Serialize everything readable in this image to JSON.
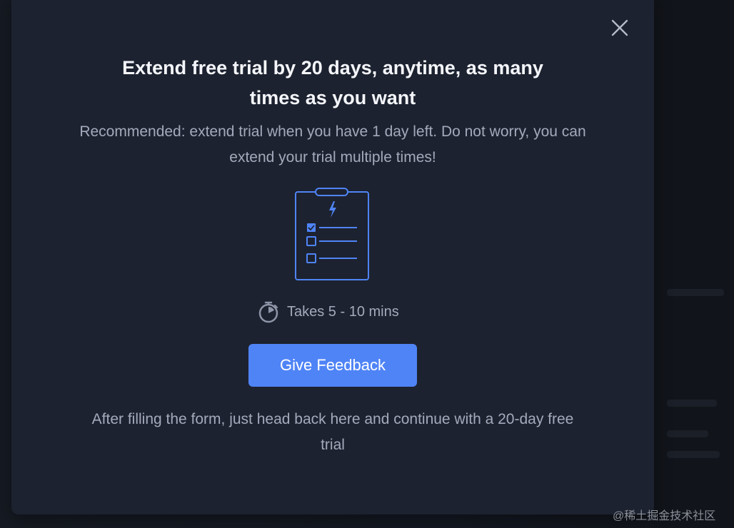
{
  "modal": {
    "title": "Extend free trial by 20 days, anytime, as many times as you want",
    "subtitle": "Recommended: extend trial when you have 1 day left. Do not worry, you can extend your trial multiple times!",
    "time_label": "Takes 5 - 10 mins",
    "primary_button_label": "Give Feedback",
    "footer_text": "After filling the form, just head back here and continue with a 20-day free trial",
    "close_icon": "close-icon",
    "illustration_icon": "clipboard-checklist-icon",
    "timer_icon": "stopwatch-icon"
  },
  "watermark": "@稀土掘金技术社区",
  "colors": {
    "background": "#12151c",
    "modal_background": "#1d2230",
    "primary_button": "#4f84f6",
    "title_text": "#f4f6fb",
    "body_text": "#a3aabb",
    "illustration_accent": "#4f84f6"
  }
}
